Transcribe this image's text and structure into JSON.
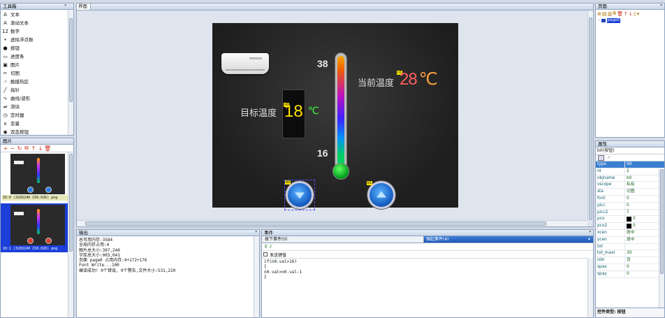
{
  "toolbox": {
    "title": "工具箱",
    "items": [
      {
        "icon": "A",
        "label": "文本"
      },
      {
        "icon": "A",
        "label": "滚动文本"
      },
      {
        "icon": "12",
        "label": "数字"
      },
      {
        "icon": "•",
        "label": "虚拟浮点数"
      },
      {
        "icon": "●",
        "label": "按钮"
      },
      {
        "icon": "▭",
        "label": "进度条"
      },
      {
        "icon": "▣",
        "label": "图片"
      },
      {
        "icon": "✂",
        "label": "切图"
      },
      {
        "icon": "☝",
        "label": "触摸热区"
      },
      {
        "icon": "╱",
        "label": "指针"
      },
      {
        "icon": "∿",
        "label": "曲线/波形"
      },
      {
        "icon": "⇌",
        "label": "滑块"
      },
      {
        "icon": "◷",
        "label": "定时器"
      },
      {
        "icon": "x",
        "label": "变量"
      },
      {
        "icon": "◉",
        "label": "双态按钮"
      }
    ]
  },
  "pictures": {
    "title": "图片",
    "items": [
      {
        "caption": "ID:0 (320X240 150.02K) png"
      },
      {
        "caption": "ID:1 (320X240 150.02K) png"
      }
    ]
  },
  "canvas": {
    "title": "界面",
    "temp_max": "38",
    "temp_min": "16",
    "current_label": "当前温度",
    "current_value": "28",
    "current_unit": "℃",
    "target_label": "目标温度",
    "target_value": "18",
    "target_unit": "℃",
    "badge_b0": "b0",
    "badge_b1": "b1",
    "badge_n0": "n0",
    "badge_n1": "n1"
  },
  "pages": {
    "title": "页面",
    "items": [
      {
        "label": "page0"
      }
    ]
  },
  "output": {
    "title": "输出",
    "lines": [
      "总可用内存:3584",
      "全局内存占用:4",
      "图片总大小:307,240",
      "字库总大小:003,041",
      "页面 page0 占用内存:4+172+176",
      "Font Write...100",
      "编译成功! 0个错误, 0个警告,文件大小:531,220"
    ]
  },
  "events": {
    "title": "事件",
    "tab_press": "按下事件(0)",
    "tab_release": "弹起事件(4)",
    "send_key_label": "发送键值",
    "code": [
      "if(n0.val>16)",
      "{",
      "n0.val=n0.val-1",
      "}"
    ]
  },
  "properties": {
    "title": "属性",
    "object": "b0(按钮)",
    "rows": [
      {
        "k": "type",
        "v": "98",
        "selected": true
      },
      {
        "k": "id",
        "v": "2"
      },
      {
        "k": "objname",
        "v": "b0"
      },
      {
        "k": "vscope",
        "v": "私有"
      },
      {
        "k": "sta",
        "v": "切图"
      },
      {
        "k": "font",
        "v": "0"
      },
      {
        "k": "picc",
        "v": "0"
      },
      {
        "k": "picc2",
        "v": "1"
      },
      {
        "k": "pco",
        "v": "0",
        "swatch": true
      },
      {
        "k": "pco2",
        "v": "0",
        "swatch": true
      },
      {
        "k": "xcen",
        "v": "居中"
      },
      {
        "k": "ycen",
        "v": "居中"
      },
      {
        "k": "txt",
        "v": ""
      },
      {
        "k": "txt_maxl",
        "v": "30"
      },
      {
        "k": "isbr",
        "v": "否"
      },
      {
        "k": "spax",
        "v": "0"
      },
      {
        "k": "spay",
        "v": "0"
      }
    ],
    "footer_label": "控件类型: 按钮"
  },
  "colors": {
    "panel_border": "#8fa3bf",
    "selection": "#1b4fd8",
    "canvas_bg": "#2b2b2b"
  }
}
